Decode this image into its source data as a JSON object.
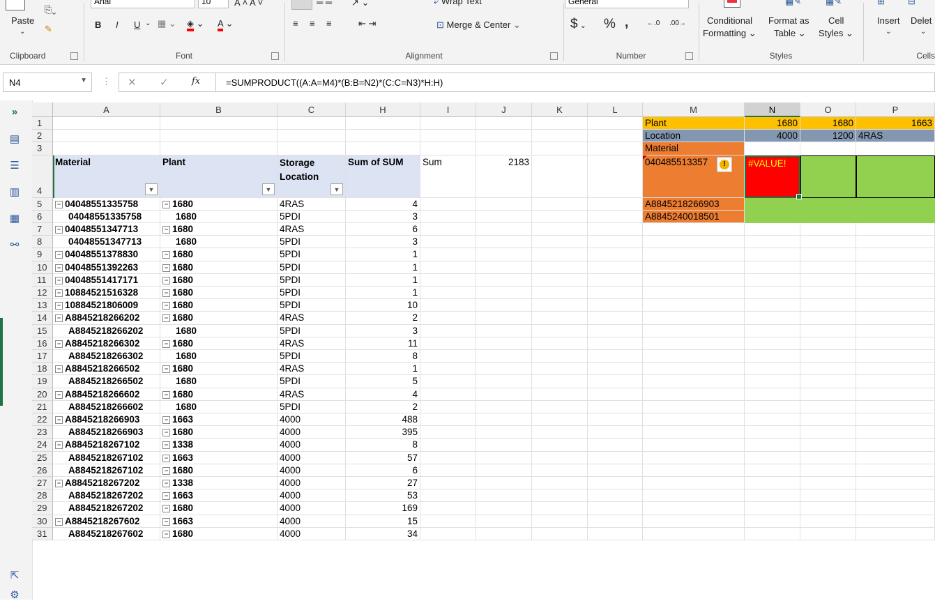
{
  "ribbon": {
    "clipboard": {
      "label": "Clipboard",
      "paste": "Paste"
    },
    "font": {
      "label": "Font",
      "name": "Arial",
      "size": "10",
      "bold": "B",
      "italic": "I",
      "underline": "U"
    },
    "alignment": {
      "label": "Alignment",
      "wrap": "Wrap Text",
      "merge": "Merge & Center"
    },
    "number": {
      "label": "Number",
      "format": "General",
      "currency": "$",
      "percent": "%",
      "comma": ","
    },
    "styles": {
      "label": "Styles",
      "conditional": "Conditional",
      "formatting": "Formatting",
      "format_as": "Format as",
      "table": "Table",
      "cell": "Cell",
      "cell_styles": "Styles"
    },
    "cells": {
      "label": "Cells",
      "insert": "Insert",
      "delete": "Delet"
    }
  },
  "formula_bar": {
    "name_box": "N4",
    "fx": "fx",
    "formula": "=SUMPRODUCT((A:A=M4)*(B:B=N2)*(C:C=N3)*H:H)"
  },
  "columns": [
    "A",
    "B",
    "C",
    "H",
    "I",
    "J",
    "K",
    "L",
    "M",
    "N",
    "O",
    "P"
  ],
  "pivot_headers": {
    "material": "Material",
    "plant": "Plant",
    "storage": "Storage",
    "storage2": "Location",
    "sum": "Sum of SUM"
  },
  "sum_label": "Sum",
  "sum_value": "2183",
  "rows": [
    {
      "n": "5",
      "a": "04048551335758",
      "b": "1680",
      "c": "4RAS",
      "h": "4",
      "ta": true,
      "tb": true
    },
    {
      "n": "6",
      "a": "04048551335758",
      "b": "1680",
      "c": "5PDI",
      "h": "3",
      "ta": false,
      "tb": false
    },
    {
      "n": "7",
      "a": "04048551347713",
      "b": "1680",
      "c": "4RAS",
      "h": "6",
      "ta": true,
      "tb": true
    },
    {
      "n": "8",
      "a": "04048551347713",
      "b": "1680",
      "c": "5PDI",
      "h": "3",
      "ta": false,
      "tb": false
    },
    {
      "n": "9",
      "a": "04048551378830",
      "b": "1680",
      "c": "5PDI",
      "h": "1",
      "ta": true,
      "tb": true
    },
    {
      "n": "10",
      "a": "04048551392263",
      "b": "1680",
      "c": "5PDI",
      "h": "1",
      "ta": true,
      "tb": true
    },
    {
      "n": "11",
      "a": "04048551417171",
      "b": "1680",
      "c": "5PDI",
      "h": "1",
      "ta": true,
      "tb": true
    },
    {
      "n": "12",
      "a": "10884521516328",
      "b": "1680",
      "c": "5PDI",
      "h": "1",
      "ta": true,
      "tb": true
    },
    {
      "n": "13",
      "a": "10884521806009",
      "b": "1680",
      "c": "5PDI",
      "h": "10",
      "ta": true,
      "tb": true
    },
    {
      "n": "14",
      "a": "A8845218266202",
      "b": "1680",
      "c": "4RAS",
      "h": "2",
      "ta": true,
      "tb": true
    },
    {
      "n": "15",
      "a": "A8845218266202",
      "b": "1680",
      "c": "5PDI",
      "h": "3",
      "ta": false,
      "tb": false
    },
    {
      "n": "16",
      "a": "A8845218266302",
      "b": "1680",
      "c": "4RAS",
      "h": "11",
      "ta": true,
      "tb": true
    },
    {
      "n": "17",
      "a": "A8845218266302",
      "b": "1680",
      "c": "5PDI",
      "h": "8",
      "ta": false,
      "tb": false
    },
    {
      "n": "18",
      "a": "A8845218266502",
      "b": "1680",
      "c": "4RAS",
      "h": "1",
      "ta": true,
      "tb": true
    },
    {
      "n": "19",
      "a": "A8845218266502",
      "b": "1680",
      "c": "5PDI",
      "h": "5",
      "ta": false,
      "tb": false
    },
    {
      "n": "20",
      "a": "A8845218266602",
      "b": "1680",
      "c": "4RAS",
      "h": "4",
      "ta": true,
      "tb": true
    },
    {
      "n": "21",
      "a": "A8845218266602",
      "b": "1680",
      "c": "5PDI",
      "h": "2",
      "ta": false,
      "tb": false
    },
    {
      "n": "22",
      "a": "A8845218266903",
      "b": "1663",
      "c": "4000",
      "h": "488",
      "ta": true,
      "tb": true
    },
    {
      "n": "23",
      "a": "A8845218266903",
      "b": "1680",
      "c": "4000",
      "h": "395",
      "ta": false,
      "tb": true
    },
    {
      "n": "24",
      "a": "A8845218267102",
      "b": "1338",
      "c": "4000",
      "h": "8",
      "ta": true,
      "tb": true
    },
    {
      "n": "25",
      "a": "A8845218267102",
      "b": "1663",
      "c": "4000",
      "h": "57",
      "ta": false,
      "tb": true
    },
    {
      "n": "26",
      "a": "A8845218267102",
      "b": "1680",
      "c": "4000",
      "h": "6",
      "ta": false,
      "tb": true
    },
    {
      "n": "27",
      "a": "A8845218267202",
      "b": "1338",
      "c": "4000",
      "h": "27",
      "ta": true,
      "tb": true
    },
    {
      "n": "28",
      "a": "A8845218267202",
      "b": "1663",
      "c": "4000",
      "h": "53",
      "ta": false,
      "tb": true
    },
    {
      "n": "29",
      "a": "A8845218267202",
      "b": "1680",
      "c": "4000",
      "h": "169",
      "ta": false,
      "tb": true
    },
    {
      "n": "30",
      "a": "A8845218267602",
      "b": "1663",
      "c": "4000",
      "h": "15",
      "ta": true,
      "tb": true
    },
    {
      "n": "31",
      "a": "A8845218267602",
      "b": "1680",
      "c": "4000",
      "h": "34",
      "ta": false,
      "tb": true
    }
  ],
  "side_table": {
    "plant_label": "Plant",
    "plant_n": "1680",
    "plant_o": "1680",
    "plant_p": "1663",
    "loc_label": "Location",
    "loc_n": "4000",
    "loc_o": "1200",
    "loc_p": "4RAS",
    "mat_label": "Material",
    "mat_1": "040485513357",
    "mat_2": "A8845218266903",
    "mat_3": "A8845240018501",
    "error": "#VALUE!"
  },
  "colors": {
    "orange_header": "#ffc000",
    "slate": "#8497b0",
    "orange": "#ed7d31",
    "green": "#92d050",
    "error_red": "#ff0000",
    "excel_green": "#217346"
  }
}
